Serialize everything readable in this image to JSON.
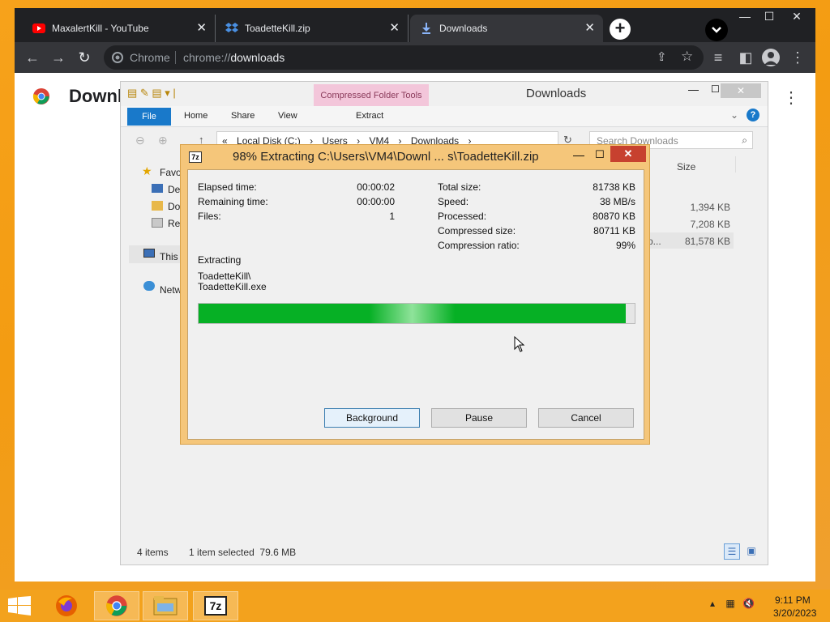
{
  "browser": {
    "tabs": [
      {
        "label": "MaxalertKill - YouTube",
        "icon": "youtube-icon"
      },
      {
        "label": "ToadetteKill.zip",
        "icon": "dropbox-icon"
      },
      {
        "label": "Downloads",
        "icon": "download-icon"
      }
    ],
    "omnibox": {
      "scheme": "Chrome",
      "url_prefix": "chrome://",
      "url_path": "downloads"
    },
    "page_title": "Downl"
  },
  "explorer": {
    "title": "Downloads",
    "context_tab": "Compressed Folder Tools",
    "ribbon_tabs": {
      "file": "File",
      "home": "Home",
      "share": "Share",
      "view": "View",
      "extract": "Extract"
    },
    "address": {
      "prefix": "«",
      "parts": [
        "Local Disk (C:)",
        "›",
        "Users",
        "›",
        "VM4",
        "›",
        "Downloads",
        "›"
      ]
    },
    "search_placeholder": "Search Downloads",
    "nav": {
      "favorites": "Favo",
      "desktop": "De",
      "downloads": "Do",
      "recent": "Re",
      "this_pc": "This",
      "network": "Netw"
    },
    "size_header": "Size",
    "sizes": [
      "1,394 KB",
      "7,208 KB",
      "81,578 KB"
    ],
    "truncated_name": "p...",
    "status": {
      "items": "4 items",
      "selected": "1 item selected  79.6 MB"
    }
  },
  "sevenzip": {
    "title": "98% Extracting C:\\Users\\VM4\\Downl ... s\\ToadetteKill.zip",
    "stats_left": [
      {
        "label": "Elapsed time:",
        "value": "00:00:02"
      },
      {
        "label": "Remaining time:",
        "value": "00:00:00"
      },
      {
        "label": "Files:",
        "value": "1"
      }
    ],
    "stats_right": [
      {
        "label": "Total size:",
        "value": "81738 KB"
      },
      {
        "label": "Speed:",
        "value": "38 MB/s"
      },
      {
        "label": "Processed:",
        "value": "80870 KB"
      },
      {
        "label": "Compressed size:",
        "value": "80711 KB"
      },
      {
        "label": "Compression ratio:",
        "value": "99%"
      }
    ],
    "status_label": "Extracting",
    "current_path_line1": "ToadetteKill\\",
    "current_path_line2": "ToadetteKill.exe",
    "progress_fraction": 0.98,
    "buttons": {
      "background": "Background",
      "pause": "Pause",
      "cancel": "Cancel"
    }
  },
  "taskbar": {
    "time": "9:11 PM",
    "date": "3/20/2023"
  }
}
